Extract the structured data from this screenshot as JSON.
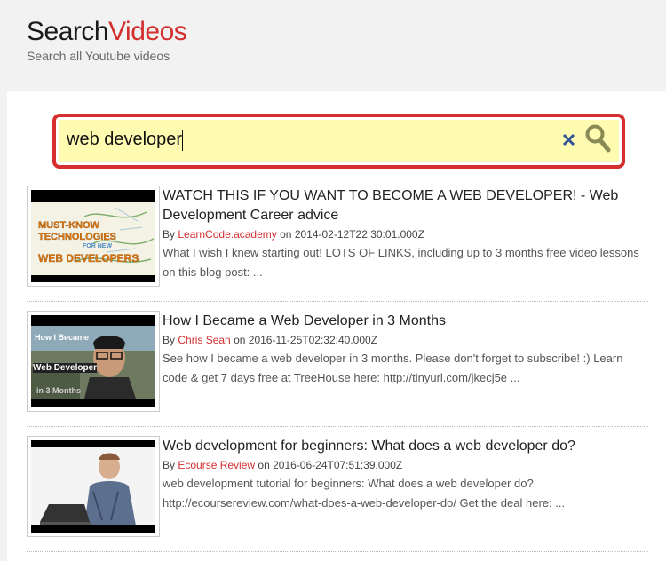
{
  "header": {
    "brand_part1": "Search",
    "brand_part2": "Videos",
    "tagline": "Search all Youtube videos"
  },
  "search": {
    "query": "web developer",
    "clear_icon": "close-icon",
    "search_icon": "search-icon"
  },
  "colors": {
    "accent": "#d32f2f",
    "search_bg": "#fffcb2",
    "header_bg": "#f2f2f2"
  },
  "results": [
    {
      "title": "WATCH THIS IF YOU WANT TO BECOME A WEB DEVELOPER! - Web Development Career advice",
      "by": "By",
      "channel": "LearnCode.academy",
      "on": "on",
      "date": "2014-02-12T22:30:01.000Z",
      "description": "What I wish I knew starting out! LOTS OF LINKS, including up to 3 months free video lessons on this blog post: ...",
      "thumb_lines": [
        "MUST-KNOW",
        "TECHNOLOGIES",
        "FOR NEW",
        "WEB DEVELOPERS"
      ]
    },
    {
      "title": "How I Became a Web Developer in 3 Months",
      "by": "By",
      "channel": "Chris Sean",
      "on": "on",
      "date": "2016-11-25T02:32:40.000Z",
      "description": "See how I became a web developer in 3 months. Please don't forget to subscribe! :) Learn code & get 7 days free at TreeHouse here: http://tinyurl.com/jkecj5e ...",
      "thumb_lines": [
        "How I Became",
        "Web Developer",
        "in 3 Months"
      ]
    },
    {
      "title": "Web development for beginners: What does a web developer do?",
      "by": "By",
      "channel": "Ecourse Review",
      "on": "on",
      "date": "2016-06-24T07:51:39.000Z",
      "description": "web development tutorial for beginners: What does a web developer do? http://ecoursereview.com/what-does-a-web-developer-do/ Get the deal here: ...",
      "thumb_lines": []
    }
  ]
}
